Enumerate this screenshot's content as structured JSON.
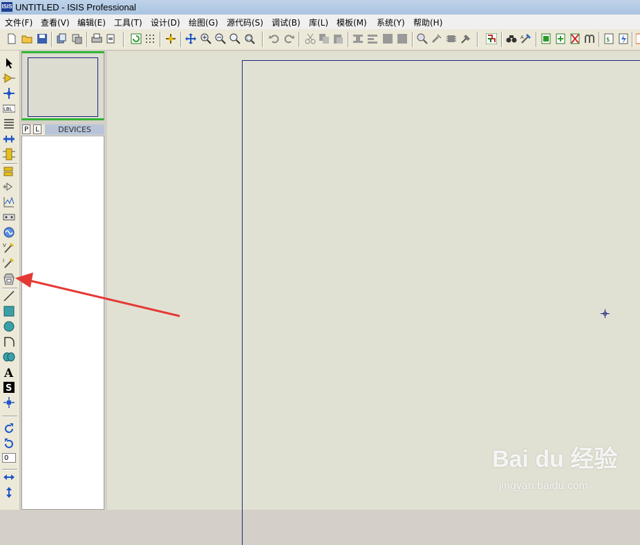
{
  "window": {
    "title": "UNTITLED - ISIS Professional",
    "app_icon_text": "ISIS"
  },
  "menu": [
    "文件(F)",
    "查看(V)",
    "编辑(E)",
    "工具(T)",
    "设计(D)",
    "绘图(G)",
    "源代码(S)",
    "调试(B)",
    "库(L)",
    "模板(M)",
    "系统(Y)",
    "帮助(H)"
  ],
  "toolbar_icons": [
    "new-file-icon",
    "open-folder-icon",
    "save-icon",
    "import-icon",
    "export-icon",
    "print-icon",
    "print-setup-icon",
    "refresh-icon",
    "grid-icon",
    "origin-icon",
    "pan-icon",
    "zoom-in-icon",
    "zoom-out-icon",
    "zoom-all-icon",
    "zoom-area-icon",
    "undo-icon",
    "redo-icon",
    "cut-icon",
    "copy-icon",
    "paste-icon",
    "block-copy-icon",
    "block-move-icon",
    "block-rotate-icon",
    "block-delete-icon",
    "pick-device-icon",
    "make-device-icon",
    "packaging-icon",
    "decompose-icon",
    "wire-autorouter-icon",
    "search-tag-icon",
    "property-tool-icon",
    "new-sheet-icon",
    "add-sheet-icon",
    "remove-sheet-icon",
    "goto-child-icon",
    "bill-of-materials-icon",
    "electrical-rule-check-icon",
    "netlist-icon"
  ],
  "left_tools": [
    "selection-mode-icon",
    "component-mode-icon",
    "junction-dot-icon",
    "wire-label-icon",
    "text-script-icon",
    "buses-icon",
    "subcircuit-icon",
    "terminals-icon",
    "device-pins-icon",
    "graph-icon",
    "tape-recorder-icon",
    "generator-icon",
    "voltage-probe-icon",
    "current-probe-icon",
    "virtual-instruments-icon",
    "line-icon",
    "box-icon",
    "circle-icon",
    "arc-icon",
    "path-icon",
    "text-icon",
    "symbol-icon",
    "marker-icon",
    "rotate-clockwise-icon",
    "rotate-anticlockwise-icon",
    "mirror-horizontal-icon",
    "mirror-vertical-icon"
  ],
  "rotation_value": "0",
  "device_panel": {
    "tab_p": "P",
    "tab_l": "L",
    "label": "DEVICES"
  },
  "watermark": {
    "logo": "Bai du 经验",
    "sub": "jingyan.baidu.com"
  },
  "colors": {
    "accent_green": "#2fb534",
    "sheet_border": "#1a237e",
    "arrow": "#e53935"
  }
}
